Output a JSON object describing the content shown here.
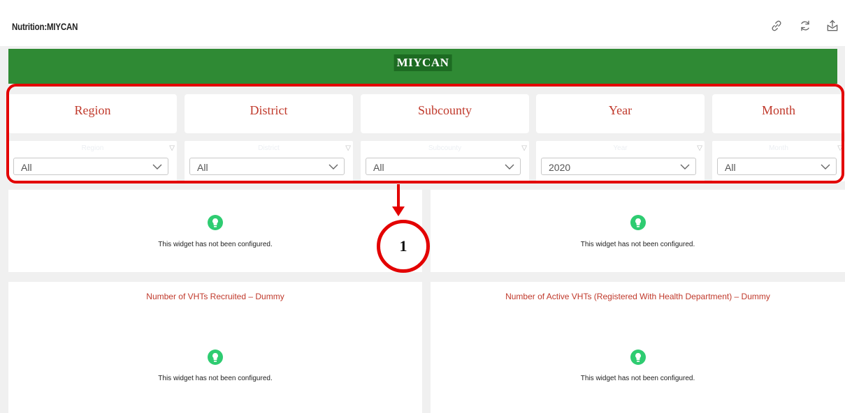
{
  "header": {
    "title": "Nutrition:MIYCAN",
    "icons": [
      "link-icon",
      "refresh-icon",
      "export-icon"
    ]
  },
  "banner": {
    "title": "MIYCAN"
  },
  "filters": [
    {
      "label": "Region",
      "placeholder": "Region",
      "value": "All"
    },
    {
      "label": "District",
      "placeholder": "District",
      "value": "All"
    },
    {
      "label": "Subcounty",
      "placeholder": "Subcounty",
      "value": "All"
    },
    {
      "label": "Year",
      "placeholder": "Year",
      "value": "2020"
    },
    {
      "label": "Month",
      "placeholder": "Month",
      "value": "All"
    }
  ],
  "callout": {
    "number": "1"
  },
  "widgets": [
    {
      "title": "",
      "message": "This widget has not been configured."
    },
    {
      "title": "",
      "message": "This widget has not been configured."
    },
    {
      "title": "Number of VHTs Recruited – Dummy",
      "message": "This widget has not been configured."
    },
    {
      "title": "Number of Active VHTs (Registered With Health Department) – Dummy",
      "message": "This widget has not been configured."
    }
  ],
  "colors": {
    "banner": "#2f8a34",
    "banner_title_bg": "#1d6b22",
    "filter_label": "#c0392b",
    "widget_title": "#c0392b",
    "widget_icon": "#2ecc71",
    "annotation": "#e30000"
  }
}
